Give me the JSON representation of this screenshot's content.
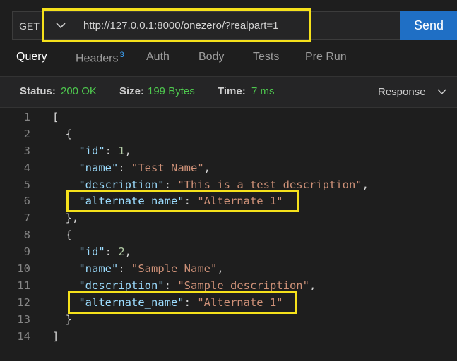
{
  "request": {
    "method": "GET",
    "url": "http://127.0.0.1:8000/onezero/?realpart=1",
    "send_label": "Send"
  },
  "tabs": [
    {
      "label": "Query",
      "active": true
    },
    {
      "label": "Headers",
      "badge": "3"
    },
    {
      "label": "Auth"
    },
    {
      "label": "Body"
    },
    {
      "label": "Tests"
    },
    {
      "label": "Pre Run"
    }
  ],
  "status": {
    "status_label": "Status:",
    "status_value": "200 OK",
    "size_label": "Size:",
    "size_value": "199 Bytes",
    "time_label": "Time:",
    "time_value": "7 ms",
    "view_label": "Response"
  },
  "code_lines": [
    {
      "n": "1",
      "text": "["
    },
    {
      "n": "2",
      "text": "  {"
    },
    {
      "n": "3",
      "key": "\"id\"",
      "sep": ": ",
      "num": "1",
      "tail": ","
    },
    {
      "n": "4",
      "key": "\"name\"",
      "sep": ": ",
      "str": "\"Test Name\"",
      "tail": ","
    },
    {
      "n": "5",
      "key": "\"description\"",
      "sep": ": ",
      "str": "\"This is a test description\"",
      "tail": ","
    },
    {
      "n": "6",
      "key": "\"alternate_name\"",
      "sep": ": ",
      "str": "\"Alternate 1\"",
      "tail": ""
    },
    {
      "n": "7",
      "text": "  },"
    },
    {
      "n": "8",
      "text": "  {"
    },
    {
      "n": "9",
      "key": "\"id\"",
      "sep": ": ",
      "num": "2",
      "tail": ","
    },
    {
      "n": "10",
      "key": "\"name\"",
      "sep": ": ",
      "str": "\"Sample Name\"",
      "tail": ","
    },
    {
      "n": "11",
      "key": "\"description\"",
      "sep": ": ",
      "str": "\"Sample description\"",
      "tail": ","
    },
    {
      "n": "12",
      "key": "\"alternate_name\"",
      "sep": ": ",
      "str": "\"Alternate 1\"",
      "tail": ""
    },
    {
      "n": "13",
      "text": "  }"
    },
    {
      "n": "14",
      "text": "]"
    }
  ],
  "colors": {
    "accent": "#1f6fc5",
    "status_ok": "#4ec94e",
    "highlight": "#f5e11b",
    "json_key": "#9cdcfe",
    "json_string": "#ce9178",
    "json_number": "#b5cea8"
  }
}
